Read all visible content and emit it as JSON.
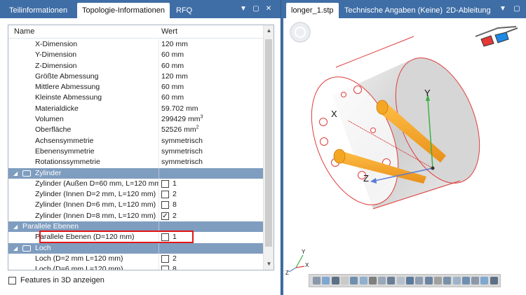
{
  "left_tabs": [
    "Teilinformationen",
    "Topologie-Informationen",
    "RFQ"
  ],
  "right_tabs": [
    "longer_1.stp",
    "Technische Angaben (Keine)",
    "2D-Ableitung"
  ],
  "grid": {
    "col_name": "Name",
    "col_value": "Wert",
    "rows": [
      {
        "name": "X-Dimension",
        "value": "120 mm"
      },
      {
        "name": "Y-Dimension",
        "value": "60 mm"
      },
      {
        "name": "Z-Dimension",
        "value": "60 mm"
      },
      {
        "name": "Größte Abmessung",
        "value": "120 mm"
      },
      {
        "name": "Mittlere Abmessung",
        "value": "60 mm"
      },
      {
        "name": "Kleinste Abmessung",
        "value": "60 mm"
      },
      {
        "name": "Materialdicke",
        "value": "59.702 mm"
      },
      {
        "name": "Volumen",
        "value": "299429 mm",
        "sup": "3"
      },
      {
        "name": "Oberfläche",
        "value": "52526 mm",
        "sup": "2"
      },
      {
        "name": "Achsensymmetrie",
        "value": "symmetrisch"
      },
      {
        "name": "Ebenensymmetrie",
        "value": "symmetrisch"
      },
      {
        "name": "Rotationssymmetrie",
        "value": "symmetrisch"
      },
      {
        "group": "Zylinder"
      },
      {
        "name": "Zylinder (Außen D=60 mm, L=120 mm)",
        "checked": false,
        "count": "1"
      },
      {
        "name": "Zylinder (Innen D=2 mm, L=120 mm)",
        "checked": false,
        "count": "2"
      },
      {
        "name": "Zylinder (Innen D=6 mm, L=120 mm)",
        "checked": false,
        "count": "8"
      },
      {
        "name": "Zylinder (Innen D=8 mm, L=120 mm)",
        "checked": true,
        "count": "2"
      },
      {
        "group": "Parallele Ebenen"
      },
      {
        "name": "Parallele Ebenen (D=120 mm)",
        "checked": false,
        "count": "1"
      },
      {
        "group": "Loch"
      },
      {
        "name": "Loch (D=2 mm L=120 mm)",
        "checked": false,
        "count": "2"
      },
      {
        "name": "Loch (D=6 mm L=120 mm)",
        "checked": false,
        "count": "8"
      }
    ]
  },
  "features_label": "Features in 3D anzeigen",
  "axes": {
    "x": "X",
    "y": "Y",
    "z": "Z"
  },
  "colors": {
    "accent": "#3f6ea6",
    "group_row": "#7f9dbf",
    "highlight": "#e21818",
    "model_edge": "#e03c3c",
    "cylinders": "#f5a623"
  },
  "icons": [
    "3d-glasses-icon",
    "rotate-view-icon"
  ]
}
